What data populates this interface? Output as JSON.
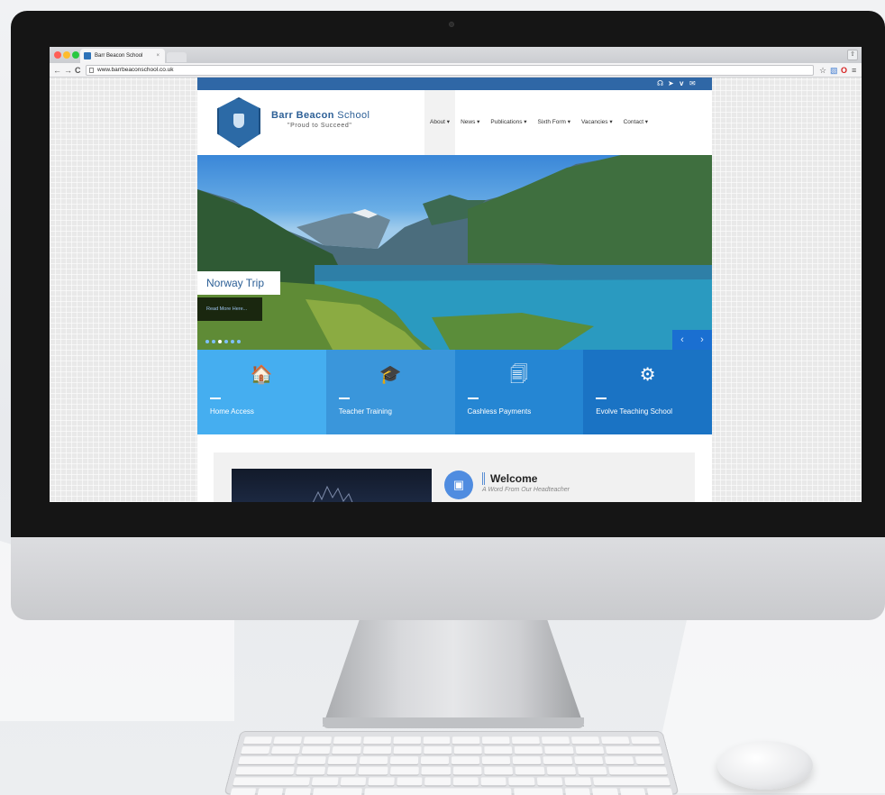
{
  "browser": {
    "tab_title": "Barr Beacon School",
    "tab_close": "×",
    "url": "www.barrbeaconschool.co.uk",
    "nav_back": "←",
    "nav_forward": "→",
    "nav_reload": "C",
    "toolbar_icons": [
      "star-icon",
      "extension-icon",
      "opera-icon",
      "menu-icon"
    ],
    "traffic_colors": [
      "#ff5f57",
      "#febc2e",
      "#28c840"
    ]
  },
  "site": {
    "social_icons": [
      "rss-icon",
      "twitter-icon",
      "vimeo-icon",
      "mail-icon"
    ],
    "social_glyphs": [
      "☊",
      "➤",
      "v",
      "✉"
    ],
    "logo": {
      "name_bold": "Barr Beacon",
      "name_light": "School",
      "tagline": "\"Proud to Succeed\""
    },
    "nav": [
      {
        "label": "About ▾",
        "active": true
      },
      {
        "label": "News ▾",
        "active": false
      },
      {
        "label": "Publications ▾",
        "active": false
      },
      {
        "label": "Sixth Form ▾",
        "active": false
      },
      {
        "label": "Vacancies ▾",
        "active": false
      },
      {
        "label": "Contact ▾",
        "active": false
      }
    ],
    "hero": {
      "caption": "Norway Trip",
      "read_more": "Read More Here...",
      "dots": 6,
      "active_dot": 2,
      "prev": "‹",
      "next": "›"
    },
    "tiles": [
      {
        "label": "Home Access",
        "icon": "home-icon",
        "glyph": "🏠",
        "color": "#45aef0"
      },
      {
        "label": "Teacher Training",
        "icon": "graduation-cap-icon",
        "glyph": "🎓",
        "color": "#3a96db"
      },
      {
        "label": "Cashless Payments",
        "icon": "documents-icon",
        "glyph": "🗐",
        "color": "#2586d3"
      },
      {
        "label": "Evolve Teaching School",
        "icon": "gear-icon",
        "glyph": "⚙",
        "color": "#1a73c4"
      }
    ],
    "welcome": {
      "title": "Welcome",
      "subtitle": "A Word From Our Headteacher",
      "icon": "film-icon",
      "glyph": "▣"
    }
  }
}
